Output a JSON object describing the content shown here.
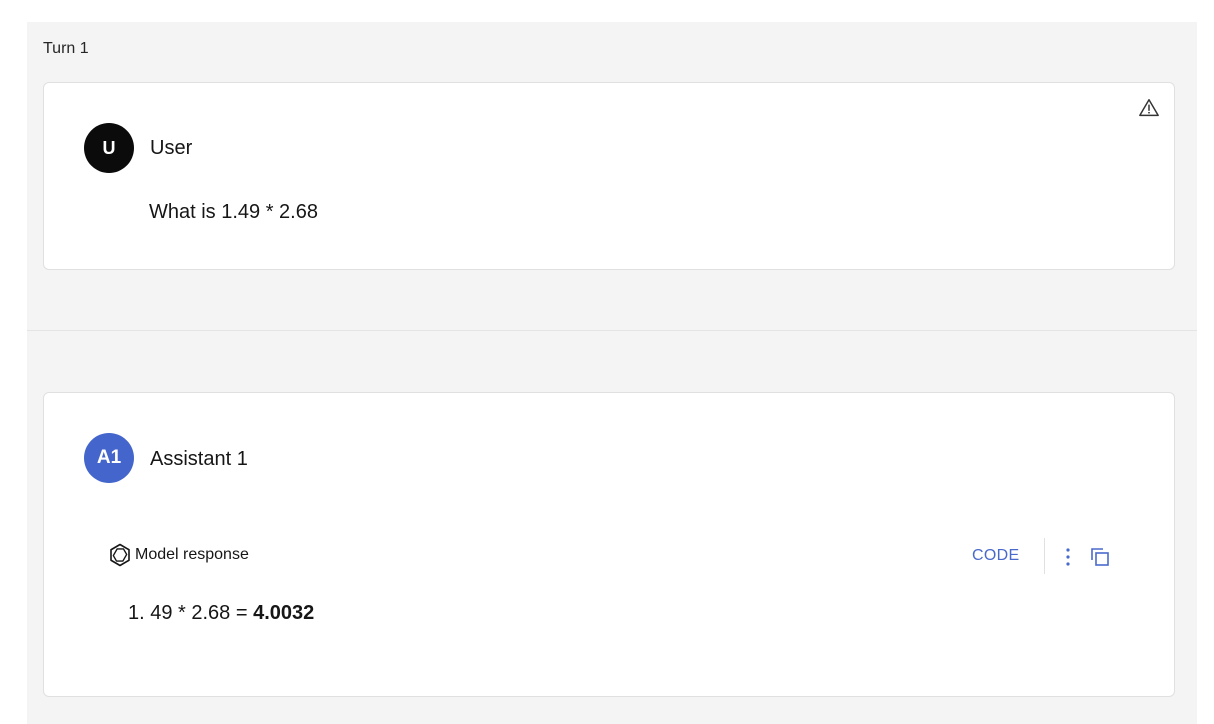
{
  "turn": {
    "label": "Turn 1"
  },
  "user": {
    "avatar_text": "U",
    "name": "User",
    "message": "What is 1.49 * 2.68"
  },
  "assistant": {
    "avatar_text": "A1",
    "name": "Assistant 1",
    "response_label": "Model response",
    "code_button": "CODE",
    "response_prefix": "1. 49 * 2.68 = ",
    "response_result": "4.0032"
  },
  "colors": {
    "panel_bg": "#f4f4f4",
    "user_avatar": "#0b0b0b",
    "assistant_avatar": "#4466cc",
    "accent": "#4a69cc"
  },
  "icons": [
    "warning-icon",
    "model-logo-icon",
    "more-vertical-icon",
    "copy-icon"
  ]
}
